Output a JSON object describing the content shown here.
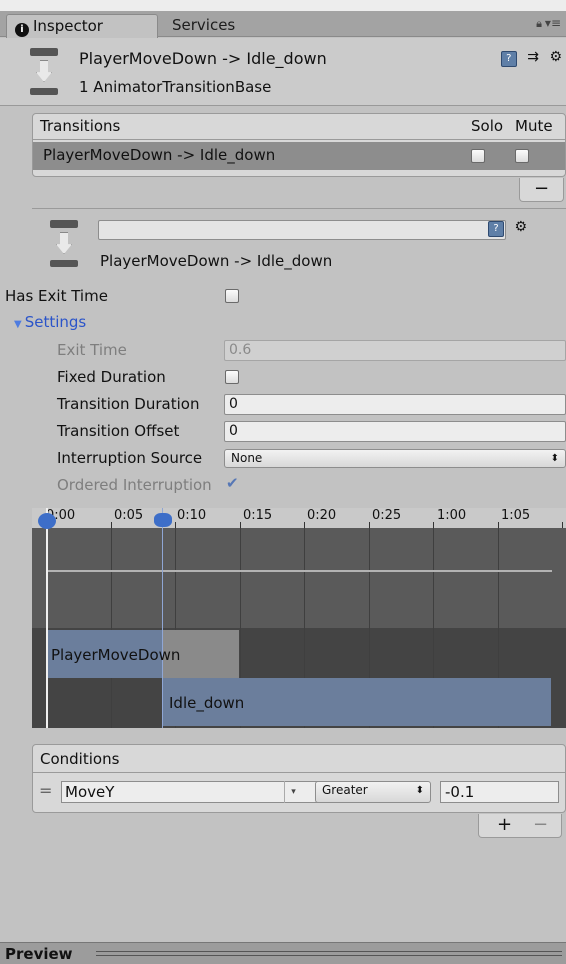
{
  "tabs": {
    "inspector": "Inspector",
    "services": "Services"
  },
  "header": {
    "title": "PlayerMoveDown -> Idle_down",
    "subtitle": "1 AnimatorTransitionBase"
  },
  "transitions": {
    "header": "Transitions",
    "solo": "Solo",
    "mute": "Mute",
    "rows": [
      {
        "label": "PlayerMoveDown -> Idle_down"
      }
    ],
    "remove_label": "−"
  },
  "sub": {
    "name_value": "",
    "title": "PlayerMoveDown -> Idle_down"
  },
  "props": {
    "has_exit_time": "Has Exit Time",
    "settings": "Settings",
    "exit_time_label": "Exit Time",
    "exit_time_value": "0.6",
    "fixed_duration": "Fixed Duration",
    "transition_duration_label": "Transition Duration",
    "transition_duration_value": "0",
    "transition_offset_label": "Transition Offset",
    "transition_offset_value": "0",
    "interruption_source_label": "Interruption Source",
    "interruption_source_value": "None",
    "ordered_interruption": "Ordered Interruption"
  },
  "timeline": {
    "ticks": [
      "0:00",
      "0:05",
      "0:10",
      "0:15",
      "0:20",
      "0:25",
      "1:00",
      "1:05"
    ],
    "source_clip": "PlayerMoveDown",
    "dest_clip": "Idle_down"
  },
  "conditions": {
    "header": "Conditions",
    "rows": [
      {
        "parameter": "MoveY",
        "mode": "Greater",
        "threshold": "-0.1"
      }
    ],
    "add_label": "+",
    "remove_label": "−"
  },
  "preview": {
    "label": "Preview"
  }
}
